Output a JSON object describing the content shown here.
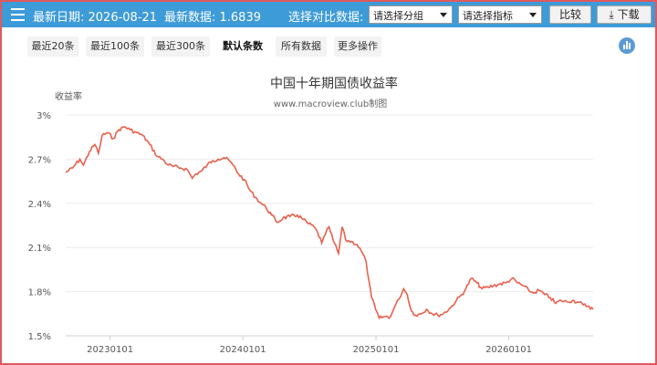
{
  "header": {
    "latest_date": "最新日期: 2026-08-21",
    "latest_value": "最新数据: 1.6839",
    "compare_label": "选择对比数据:",
    "group_select": "请选择分组",
    "indicator_select": "请选择指标",
    "compare_button": "比较",
    "download_button": "下载"
  },
  "ranges": [
    {
      "label": "最近20条",
      "active": false
    },
    {
      "label": "最近100条",
      "active": false
    },
    {
      "label": "最近300条",
      "active": false
    },
    {
      "label": "默认条数",
      "active": true
    },
    {
      "label": "所有数据",
      "active": false
    },
    {
      "label": "更多操作",
      "active": false
    }
  ],
  "colors": {
    "topbar": "#3d9bd8",
    "line": "#e8604c",
    "border": "#e0595d"
  },
  "chart_data": {
    "type": "line",
    "title": "中国十年期国债收益率",
    "subtitle": "www.macroview.club制图",
    "ylabel": "收益率",
    "xlabel": "",
    "ylim": [
      1.5,
      3.0
    ],
    "yticks": [
      "3%",
      "2.7%",
      "2.4%",
      "2.1%",
      "1.8%",
      "1.5%"
    ],
    "ytick_values": [
      3.0,
      2.7,
      2.4,
      2.1,
      1.8,
      1.5
    ],
    "xticks": [
      "20230101",
      "20240101",
      "20250101",
      "20260101"
    ],
    "xlim": [
      "2022-09-01",
      "2026-08-21"
    ],
    "grid": true,
    "series": [
      {
        "values": [
          [
            "2022-09-01",
            2.61
          ],
          [
            "2022-09-20",
            2.64
          ],
          [
            "2022-10-10",
            2.7
          ],
          [
            "2022-10-20",
            2.66
          ],
          [
            "2022-11-05",
            2.75
          ],
          [
            "2022-11-20",
            2.8
          ],
          [
            "2022-11-30",
            2.74
          ],
          [
            "2022-12-10",
            2.86
          ],
          [
            "2022-12-25",
            2.88
          ],
          [
            "2023-01-10",
            2.84
          ],
          [
            "2023-01-25",
            2.9
          ],
          [
            "2023-02-10",
            2.92
          ],
          [
            "2023-02-25",
            2.9
          ],
          [
            "2023-03-15",
            2.88
          ],
          [
            "2023-04-01",
            2.86
          ],
          [
            "2023-04-20",
            2.8
          ],
          [
            "2023-05-10",
            2.72
          ],
          [
            "2023-05-25",
            2.7
          ],
          [
            "2023-06-10",
            2.66
          ],
          [
            "2023-06-25",
            2.65
          ],
          [
            "2023-07-15",
            2.64
          ],
          [
            "2023-08-01",
            2.63
          ],
          [
            "2023-08-15",
            2.57
          ],
          [
            "2023-08-25",
            2.6
          ],
          [
            "2023-09-10",
            2.62
          ],
          [
            "2023-09-25",
            2.66
          ],
          [
            "2023-10-10",
            2.69
          ],
          [
            "2023-10-25",
            2.7
          ],
          [
            "2023-11-10",
            2.71
          ],
          [
            "2023-11-25",
            2.69
          ],
          [
            "2023-12-05",
            2.66
          ],
          [
            "2023-12-20",
            2.6
          ],
          [
            "2024-01-05",
            2.56
          ],
          [
            "2024-01-20",
            2.49
          ],
          [
            "2024-02-05",
            2.44
          ],
          [
            "2024-02-20",
            2.4
          ],
          [
            "2024-03-05",
            2.37
          ],
          [
            "2024-03-20",
            2.32
          ],
          [
            "2024-04-05",
            2.27
          ],
          [
            "2024-04-20",
            2.3
          ],
          [
            "2024-05-10",
            2.31
          ],
          [
            "2024-05-30",
            2.32
          ],
          [
            "2024-06-15",
            2.29
          ],
          [
            "2024-06-30",
            2.26
          ],
          [
            "2024-07-15",
            2.24
          ],
          [
            "2024-07-25",
            2.2
          ],
          [
            "2024-08-05",
            2.13
          ],
          [
            "2024-08-15",
            2.19
          ],
          [
            "2024-08-25",
            2.24
          ],
          [
            "2024-09-05",
            2.15
          ],
          [
            "2024-09-20",
            2.06
          ],
          [
            "2024-09-30",
            2.24
          ],
          [
            "2024-10-10",
            2.15
          ],
          [
            "2024-10-25",
            2.14
          ],
          [
            "2024-11-10",
            2.12
          ],
          [
            "2024-11-25",
            2.06
          ],
          [
            "2024-12-05",
            2.0
          ],
          [
            "2024-12-12",
            1.88
          ],
          [
            "2024-12-20",
            1.76
          ],
          [
            "2024-12-31",
            1.68
          ],
          [
            "2025-01-10",
            1.62
          ],
          [
            "2025-01-25",
            1.63
          ],
          [
            "2025-02-10",
            1.63
          ],
          [
            "2025-02-20",
            1.69
          ],
          [
            "2025-03-05",
            1.75
          ],
          [
            "2025-03-18",
            1.82
          ],
          [
            "2025-03-28",
            1.78
          ],
          [
            "2025-04-08",
            1.67
          ],
          [
            "2025-04-20",
            1.64
          ],
          [
            "2025-05-05",
            1.65
          ],
          [
            "2025-05-20",
            1.68
          ],
          [
            "2025-06-05",
            1.65
          ],
          [
            "2025-06-20",
            1.64
          ],
          [
            "2025-07-05",
            1.65
          ],
          [
            "2025-07-25",
            1.69
          ],
          [
            "2025-08-10",
            1.74
          ],
          [
            "2025-08-25",
            1.78
          ],
          [
            "2025-09-05",
            1.82
          ],
          [
            "2025-09-20",
            1.89
          ],
          [
            "2025-10-05",
            1.86
          ],
          [
            "2025-10-20",
            1.82
          ],
          [
            "2025-11-05",
            1.83
          ],
          [
            "2025-11-20",
            1.84
          ],
          [
            "2025-12-05",
            1.85
          ],
          [
            "2025-12-25",
            1.86
          ],
          [
            "2026-01-10",
            1.89
          ],
          [
            "2026-01-25",
            1.86
          ],
          [
            "2026-02-10",
            1.84
          ],
          [
            "2026-02-25",
            1.81
          ],
          [
            "2026-03-10",
            1.79
          ],
          [
            "2026-03-25",
            1.81
          ],
          [
            "2026-04-10",
            1.78
          ],
          [
            "2026-04-25",
            1.76
          ],
          [
            "2026-05-10",
            1.72
          ],
          [
            "2026-05-25",
            1.74
          ],
          [
            "2026-06-10",
            1.73
          ],
          [
            "2026-06-25",
            1.74
          ],
          [
            "2026-07-10",
            1.73
          ],
          [
            "2026-07-25",
            1.71
          ],
          [
            "2026-08-10",
            1.7
          ],
          [
            "2026-08-21",
            1.68
          ]
        ]
      }
    ]
  }
}
